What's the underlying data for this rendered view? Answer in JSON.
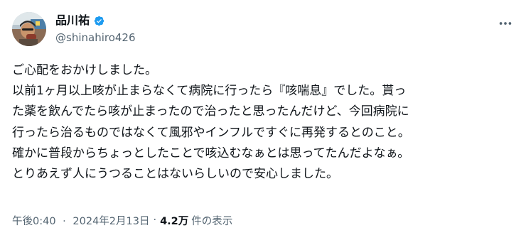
{
  "author": {
    "display_name": "品川祐",
    "handle": "@shinahiro426",
    "verified": true,
    "avatar_icon": "avatar-photo-icon",
    "verified_icon": "verified-badge-icon"
  },
  "menu": {
    "more_icon": "more-options-icon"
  },
  "tweet": {
    "lines": [
      "ご心配をおかけしました。",
      "以前1ヶ月以上咳が止まらなくて病院に行ったら『咳喘息』でした。貰っ",
      "た薬を飲んでたら咳が止まったので治ったと思ったんだけど、今回病院に",
      "行ったら治るものではなくて風邪やインフルですぐに再発するとのこと。",
      "確かに普段からちょっとしたことで咳込むなぁとは思ってたんだよなぁ。",
      "とりあえず人にうつることはないらしいので安心しました。"
    ]
  },
  "meta": {
    "time": "午後0:40",
    "separator": "·",
    "date": "2024年2月13日",
    "views_count": "4.2万",
    "views_label": "件の表示"
  },
  "colors": {
    "text": "#0f1419",
    "secondary": "#536471",
    "verified_blue": "#1d9bf0"
  }
}
